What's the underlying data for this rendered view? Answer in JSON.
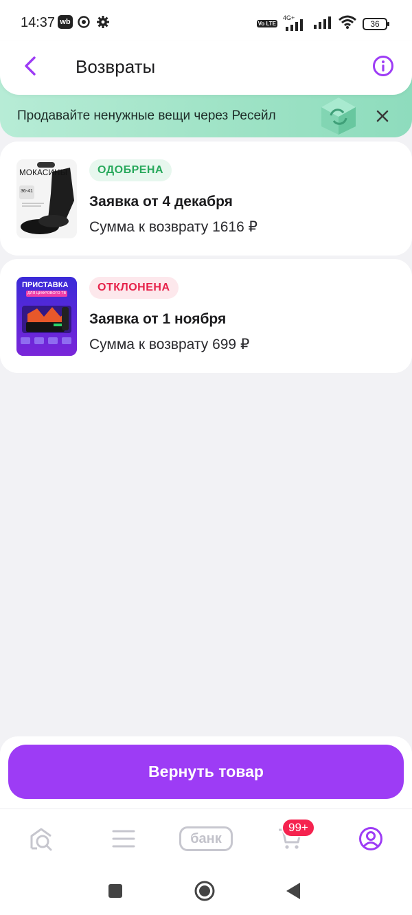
{
  "status_bar": {
    "time": "14:37",
    "wb_badge": "wb",
    "network": "4G+",
    "volte": "Vo LTE",
    "battery": "36"
  },
  "header": {
    "title": "Возвраты",
    "back_icon": "chevron-left-icon",
    "info_icon": "info-icon"
  },
  "banner": {
    "text": "Продавайте ненужные вещи через Ресейл",
    "close_icon": "close-icon"
  },
  "returns": [
    {
      "status": "ОДОБРЕНА",
      "title": "Заявка от 4 декабря",
      "amount": "Сумма к возврату 1616 ₽",
      "thumb_label": "МОКАСИНЫ",
      "thumb_size": "36-41"
    },
    {
      "status": "ОТКЛОНЕНА",
      "title": "Заявка от 1 ноября",
      "amount": "Сумма к возврату 699 ₽",
      "thumb_label": "ПРИСТАВКА",
      "thumb_sub": "ДЛЯ ЦИФРОВОГО ТВ"
    }
  ],
  "primary_action": {
    "label": "Вернуть товар"
  },
  "tab_bar": {
    "bank_label": "банк",
    "cart_badge": "99+"
  },
  "colors": {
    "accent": "#9d3cf5",
    "approved": "#28a95c",
    "rejected": "#e6224a",
    "banner": "#a6e6cb"
  }
}
